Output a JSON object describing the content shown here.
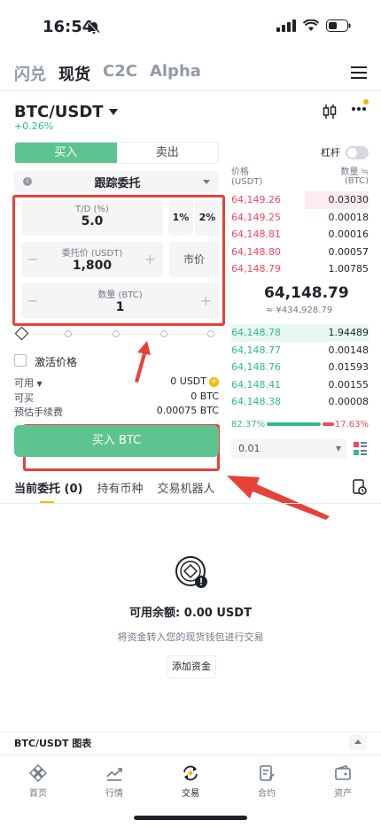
{
  "status": {
    "time": "16:54"
  },
  "nav": {
    "tabs": [
      "闪兑",
      "现货",
      "C2C",
      "Alpha"
    ],
    "active": "现货"
  },
  "pair": {
    "symbol": "BTC/USDT",
    "change": "+0.26%"
  },
  "trade": {
    "buy_label": "买入",
    "sell_label": "卖出",
    "leverage_label": "杠杆",
    "order_type": "跟踪委托",
    "td_label": "T/D (%)",
    "td_value": "5.0",
    "pct1": "1%",
    "pct2": "2%",
    "price_label": "委托价 (USDT)",
    "price_value": "1,800",
    "market_label": "市价",
    "qty_label": "数量 (BTC)",
    "qty_value": "1",
    "activate_label": "激活价格",
    "available_label": "可用",
    "available_value": "0 USDT",
    "can_buy_label": "可买",
    "can_buy_value": "0 BTC",
    "fee_label": "预估手续费",
    "fee_value": "0.00075 BTC",
    "submit_label": "买入 BTC"
  },
  "orderbook": {
    "price_header": "价格",
    "price_unit": "(USDT)",
    "qty_header": "数量 ≒",
    "qty_unit": "(BTC)",
    "asks": [
      {
        "price": "64,149.26",
        "qty": "0.03030"
      },
      {
        "price": "64,149.25",
        "qty": "0.00018"
      },
      {
        "price": "64,148.81",
        "qty": "0.00016"
      },
      {
        "price": "64,148.80",
        "qty": "0.00057"
      },
      {
        "price": "64,148.79",
        "qty": "1.00785"
      }
    ],
    "mid_price": "64,148.79",
    "mid_fiat": "≈ ¥434,928.79",
    "bids": [
      {
        "price": "64,148.78",
        "qty": "1.94489"
      },
      {
        "price": "64,148.77",
        "qty": "0.00148"
      },
      {
        "price": "64,148.76",
        "qty": "0.01593"
      },
      {
        "price": "64,148.41",
        "qty": "0.00155"
      },
      {
        "price": "64,148.38",
        "qty": "0.00008"
      }
    ],
    "buy_ratio": "82.37%",
    "sell_ratio": "17.63%",
    "buy_ratio_value": 82.37,
    "precision": "0.01"
  },
  "orders": {
    "tabs": [
      "当前委托 (0)",
      "持有币种",
      "交易机器人"
    ],
    "balance_text": "可用余额: 0.00 USDT",
    "hint": "将资金转入您的现货钱包进行交易",
    "add_funds": "添加资金"
  },
  "chart_bar": {
    "title": "BTC/USDT 图表"
  },
  "bottom_nav": [
    {
      "label": "首页",
      "icon": "home-icon"
    },
    {
      "label": "行情",
      "icon": "markets-icon"
    },
    {
      "label": "交易",
      "icon": "trade-icon"
    },
    {
      "label": "合约",
      "icon": "futures-icon"
    },
    {
      "label": "资产",
      "icon": "wallet-icon"
    }
  ],
  "colors": {
    "buy": "#5ec48f",
    "sell": "#f6465d",
    "accent": "#f0b90b",
    "annotation": "#e8413a"
  }
}
